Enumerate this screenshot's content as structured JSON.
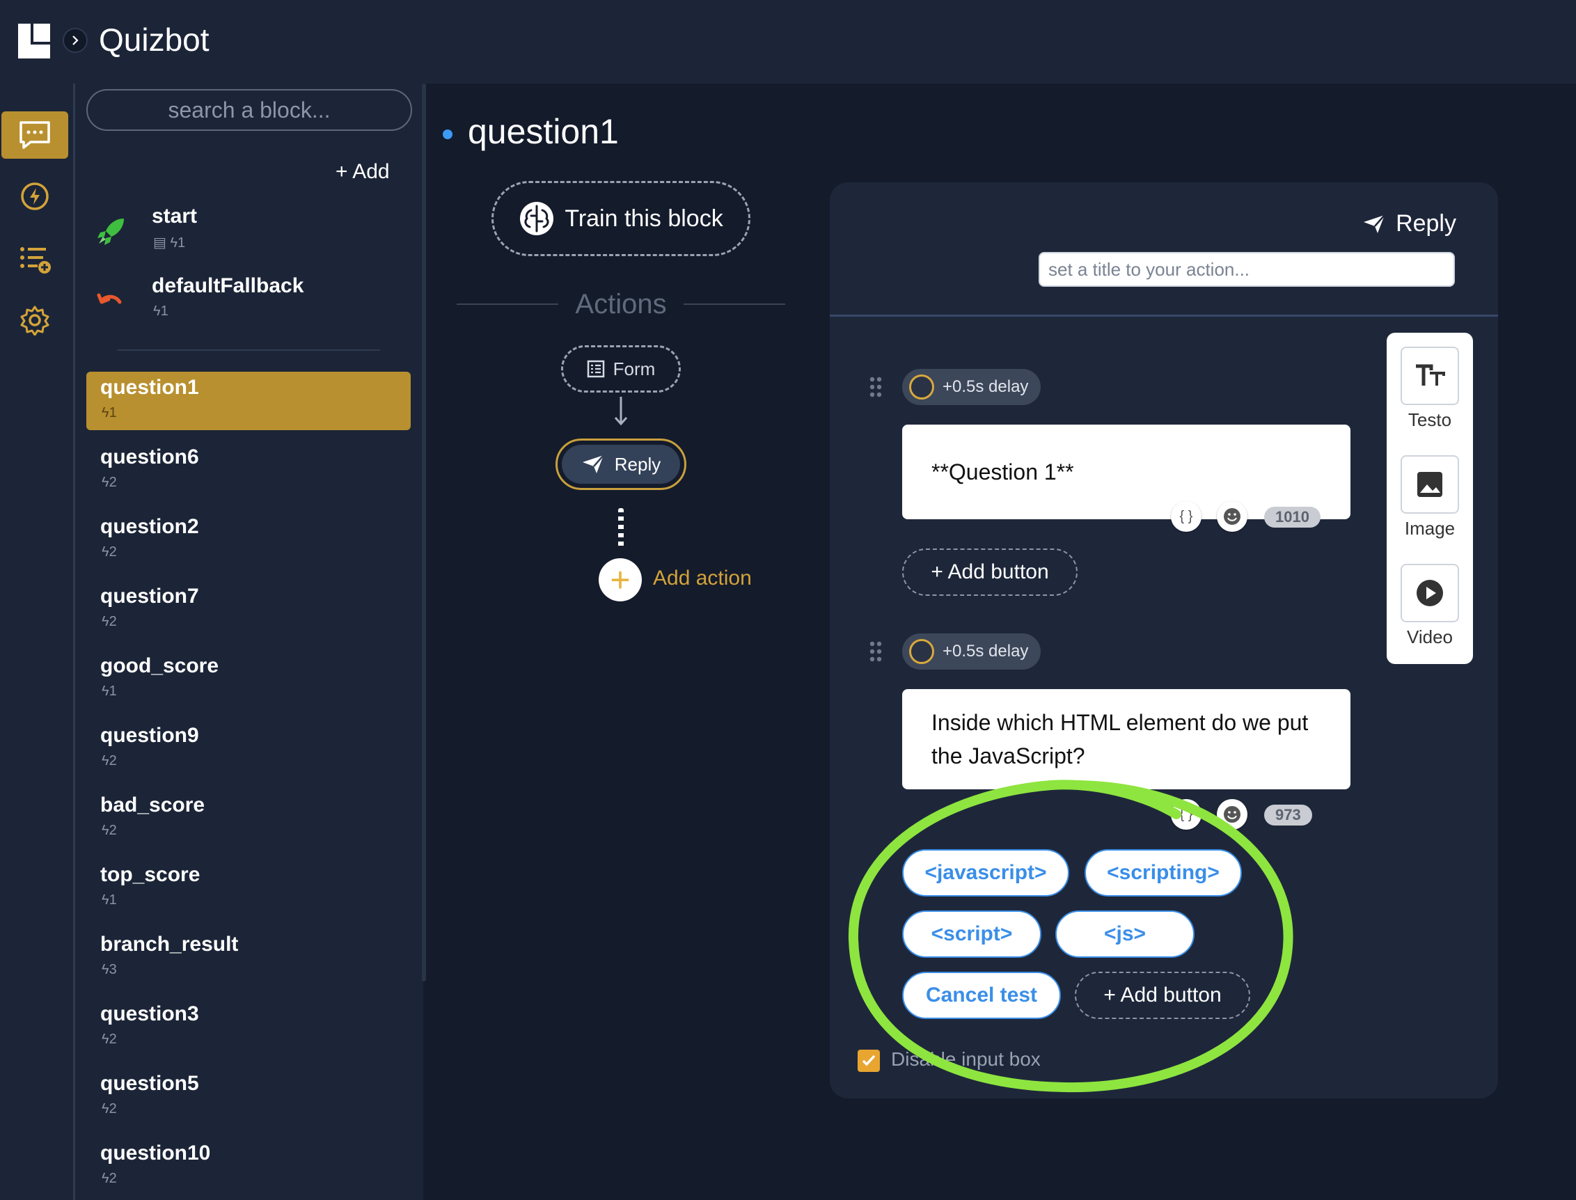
{
  "app": {
    "title": "Quizbot"
  },
  "sidebar": {
    "search_placeholder": "search a block...",
    "add_label": "+ Add",
    "special_blocks": [
      {
        "name": "start",
        "meta": "▤ ϟ1"
      },
      {
        "name": "defaultFallback",
        "meta": "ϟ1"
      }
    ],
    "blocks": [
      {
        "name": "question1",
        "meta": "ϟ1"
      },
      {
        "name": "question6",
        "meta": "ϟ2"
      },
      {
        "name": "question2",
        "meta": "ϟ2"
      },
      {
        "name": "question7",
        "meta": "ϟ2"
      },
      {
        "name": "good_score",
        "meta": "ϟ1"
      },
      {
        "name": "question9",
        "meta": "ϟ2"
      },
      {
        "name": "bad_score",
        "meta": "ϟ2"
      },
      {
        "name": "top_score",
        "meta": "ϟ1"
      },
      {
        "name": "branch_result",
        "meta": "ϟ3"
      },
      {
        "name": "question3",
        "meta": "ϟ2"
      },
      {
        "name": "question5",
        "meta": "ϟ2"
      },
      {
        "name": "question10",
        "meta": "ϟ2"
      }
    ]
  },
  "main": {
    "block_title": "question1",
    "train_label": "Train this block",
    "actions_label": "Actions",
    "flow": {
      "form_label": "Form",
      "reply_label": "Reply",
      "add_action_label": "Add action"
    }
  },
  "editor": {
    "header_label": "Reply",
    "title_placeholder": "set a title to your action...",
    "messages": [
      {
        "delay": "+0.5s delay",
        "text": "**Question 1**",
        "counter": "1010",
        "add_button": "+ Add button"
      },
      {
        "delay": "+0.5s delay",
        "text": "Inside which HTML element do we put the JavaScript?",
        "counter": "973",
        "add_button": "+ Add button"
      }
    ],
    "buttons": [
      "<javascript>",
      "<scripting>",
      "<script>",
      "<js>",
      "Cancel test"
    ],
    "disable_input_label": "Disable input box"
  },
  "palette": {
    "items": [
      "Testo",
      "Image",
      "Video"
    ]
  },
  "colors": {
    "accent": "#b8902f",
    "highlight": "#8ee53f",
    "link_blue": "#3a8ee8"
  }
}
